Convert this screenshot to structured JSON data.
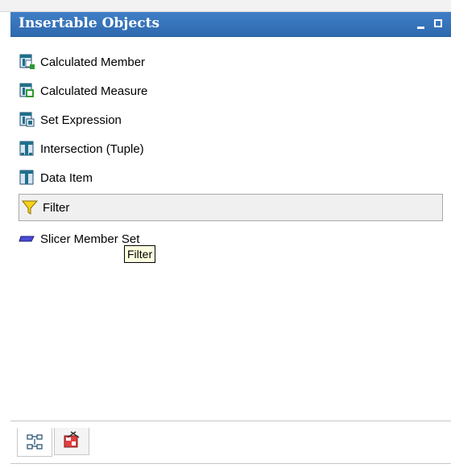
{
  "panel": {
    "title": "Insertable Objects",
    "items": [
      {
        "label": "Calculated Member",
        "icon": "calculated-member-icon"
      },
      {
        "label": "Calculated Measure",
        "icon": "calculated-measure-icon"
      },
      {
        "label": "Set Expression",
        "icon": "set-expression-icon"
      },
      {
        "label": "Intersection (Tuple)",
        "icon": "intersection-tuple-icon"
      },
      {
        "label": "Data Item",
        "icon": "data-item-icon"
      },
      {
        "label": "Filter",
        "icon": "filter-funnel-icon",
        "selected": true
      },
      {
        "label": "Slicer Member Set",
        "icon": "slicer-member-set-icon"
      }
    ],
    "tooltip": "Filter",
    "bottom_tabs": [
      {
        "icon": "source-tree-icon",
        "active": true
      },
      {
        "icon": "toolbox-icon",
        "active": false
      }
    ]
  },
  "colors": {
    "titlebar": "#2f69ae",
    "tooltip_bg": "#ffffe1",
    "selected_bg": "#f0f0f0"
  }
}
